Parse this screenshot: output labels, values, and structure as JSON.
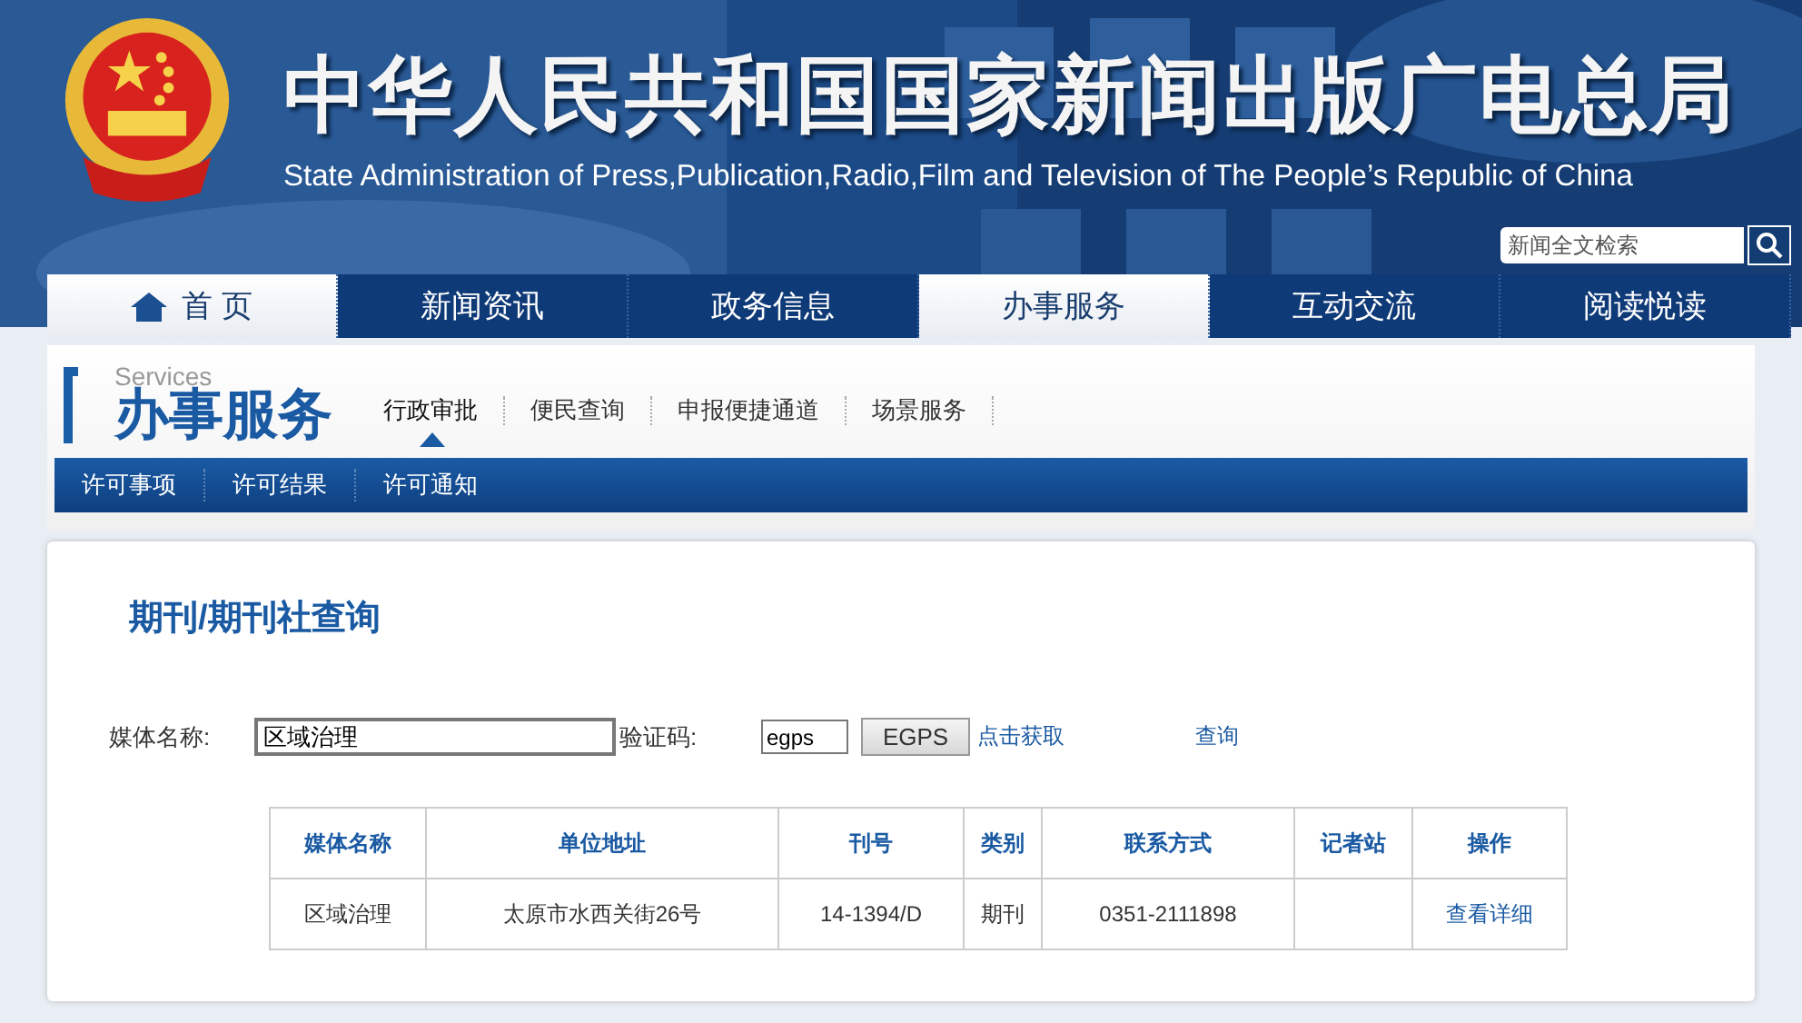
{
  "header": {
    "title": "中华人民共和国国家新闻出版广电总局",
    "subtitle": "State Administration of Press,Publication,Radio,Film and Television of The People’s Republic of China",
    "search": {
      "placeholder": "新闻全文检索"
    }
  },
  "nav": [
    {
      "label": "首 页",
      "selected": true,
      "kind": "home"
    },
    {
      "label": "新闻资讯",
      "selected": false
    },
    {
      "label": "政务信息",
      "selected": false
    },
    {
      "label": "办事服务",
      "selected": true
    },
    {
      "label": "互动交流",
      "selected": false
    },
    {
      "label": "阅读悦读",
      "selected": false
    }
  ],
  "section": {
    "caption": "Services",
    "title": "办事服务",
    "tabs": [
      {
        "label": "行政审批",
        "selected": true
      },
      {
        "label": "便民查询",
        "selected": false
      },
      {
        "label": "申报便捷通道",
        "selected": false
      },
      {
        "label": "场景服务",
        "selected": false
      }
    ],
    "subtabs": [
      {
        "label": "许可事项"
      },
      {
        "label": "许可结果"
      },
      {
        "label": "许可通知"
      }
    ]
  },
  "query": {
    "heading": "期刊/期刊社查询",
    "name_label": "媒体名称:",
    "name_value": "区域治理",
    "code_label": "验证码:",
    "code_value": "egps",
    "captcha": "EGPS",
    "refresh_link": "点击获取",
    "submit_link": "查询"
  },
  "table": {
    "columns": [
      "媒体名称",
      "单位地址",
      "刊号",
      "类别",
      "联系方式",
      "记者站",
      "操作"
    ],
    "rows": [
      {
        "cells": [
          "区域治理",
          "太原市水西关街26号",
          "14-1394/D",
          "期刊",
          "0351-2111898",
          null
        ],
        "action": "查看详细"
      }
    ]
  }
}
